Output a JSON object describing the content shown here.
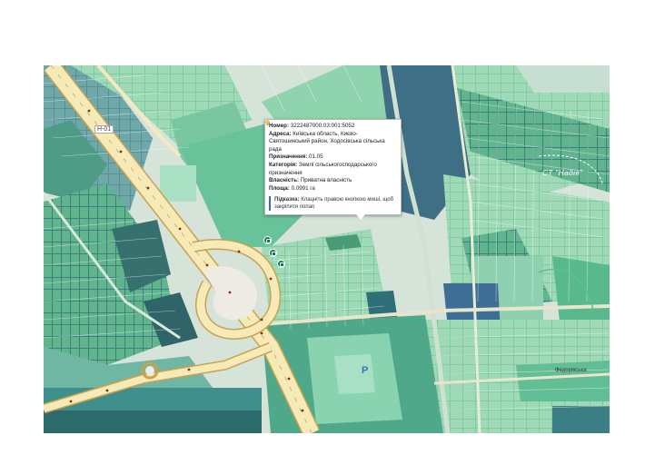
{
  "map": {
    "road_label": "Н-01",
    "street_label": "Федорівська",
    "settlement_label": "СТ \"Надія\"",
    "parking_label": "P"
  },
  "popup": {
    "number_label": "Номер:",
    "number_value": "3222487000:03:001:5052",
    "address_label": "Адреса:",
    "address_value": "Київська область, Києво-Святошинський район, Ходосівська сільська рада",
    "purpose_label": "Призначення:",
    "purpose_value": "01.05",
    "category_label": "Категорія:",
    "category_value": "Землі сільськогосподарського призначення",
    "ownership_label": "Власність:",
    "ownership_value": "Приватна власність",
    "area_label": "Площа:",
    "area_value": "0.0991 га",
    "hint_label": "Підказка:",
    "hint_text": "Клацніть правою кнопкою миші, щоб закріпити попап"
  },
  "colors": {
    "parcel_light": "#9fd9b6",
    "parcel_mid": "#5fbf93",
    "parcel_dark": "#3b7f86",
    "parcel_blue": "#4a79a6",
    "road_fill": "#f6ebb8",
    "road_edge": "#c9a24d",
    "background": "#dbe4d9",
    "marker": "#0f7a55",
    "hint_border": "#3d6fb6"
  },
  "icons": {
    "marker": "pushpin-icon",
    "hint": "lightbulb-icon"
  }
}
